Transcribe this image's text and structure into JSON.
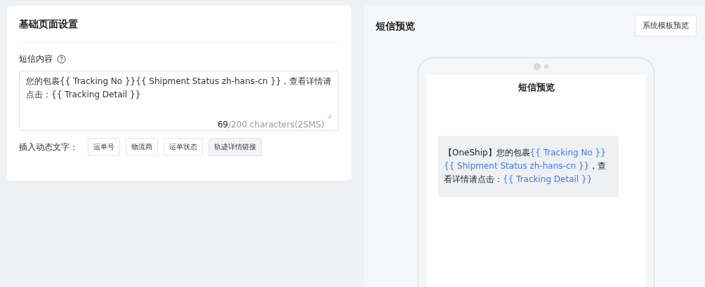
{
  "settings": {
    "title": "基础页面设置",
    "field_label": "短信内容",
    "message": "您的包裹{{ Tracking No }}{{ Shipment Status zh-hans-cn }}，查看详情请点击：{{ Tracking Detail }}",
    "counter": {
      "count": "69",
      "limit": "/200 characters(2SMS)"
    },
    "insert_label": "插入动态文字：",
    "insert_buttons": [
      {
        "label": "运单号",
        "selected": false
      },
      {
        "label": "物流商",
        "selected": false
      },
      {
        "label": "运单状态",
        "selected": false
      },
      {
        "label": "轨迹详情链接",
        "selected": true
      }
    ]
  },
  "preview": {
    "title": "短信预览",
    "button": "系统模板预览",
    "screen_title": "短信预览",
    "segments": [
      {
        "kind": "text",
        "text": "【OneShip】您的包裹"
      },
      {
        "kind": "variable",
        "text": "{{ Tracking No }}{{ Shipment Status zh-hans-cn }}"
      },
      {
        "kind": "text",
        "text": "，查看详情请点击："
      },
      {
        "kind": "variable",
        "text": "{{ Tracking Detail }}"
      }
    ]
  }
}
